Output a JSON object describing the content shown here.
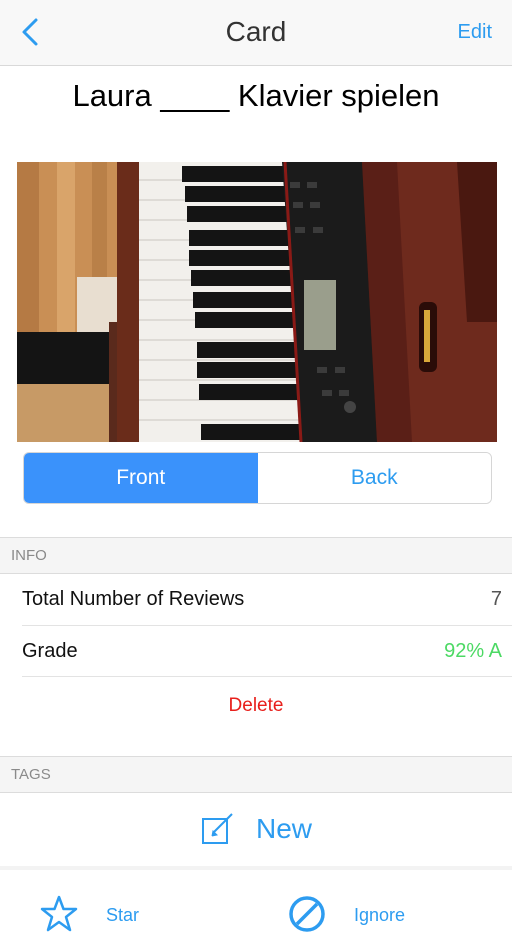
{
  "navbar": {
    "title": "Card",
    "edit_label": "Edit",
    "accent_color": "#2d9cf0"
  },
  "card": {
    "front_text": "Laura ____ Klavier spielen"
  },
  "segmented": {
    "front_label": "Front",
    "back_label": "Back",
    "selected": "Front"
  },
  "info": {
    "header": "INFO",
    "reviews_label": "Total Number of Reviews",
    "reviews_value": "7",
    "grade_label": "Grade",
    "grade_value": "92% A",
    "delete_label": "Delete"
  },
  "tags": {
    "header": "TAGS",
    "new_label": "New"
  },
  "bottom_bar": {
    "star_label": "Star",
    "ignore_label": "Ignore"
  }
}
